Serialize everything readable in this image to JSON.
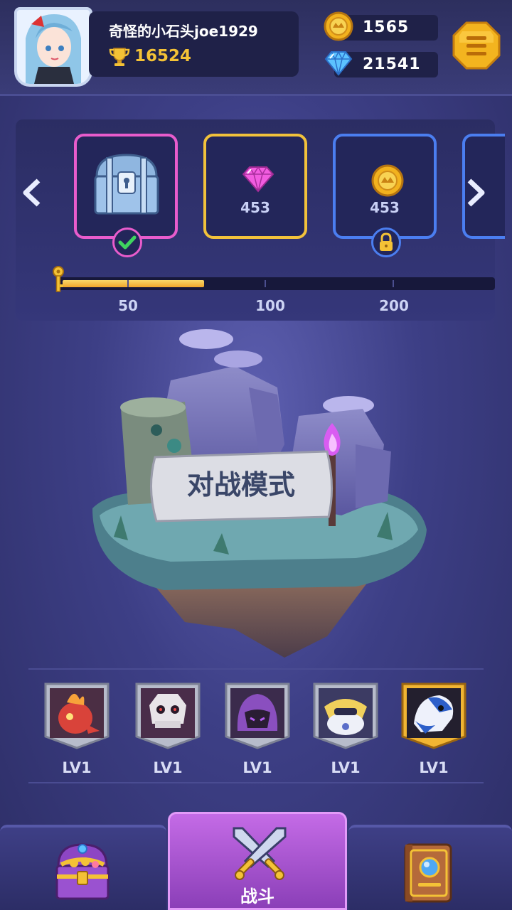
{
  "player": {
    "name": "奇怪的小石头joe1929",
    "trophies": "16524"
  },
  "currencies": {
    "gold": "1565",
    "diamonds": "21541"
  },
  "icons": {
    "menu": "menu-icon",
    "trophy": "trophy-icon",
    "gold": "gold-coin-icon",
    "diamond": "diamond-icon",
    "lock": "lock-icon",
    "check": "check-icon",
    "key": "key-icon",
    "treasure": "treasure-chest-icon",
    "battle": "crossed-swords-icon",
    "book": "spellbook-icon"
  },
  "rewards": [
    {
      "type": "chest",
      "value": "",
      "status": "claimed"
    },
    {
      "type": "diamond",
      "value": "453",
      "status": "available"
    },
    {
      "type": "gold",
      "value": "453",
      "status": "locked"
    }
  ],
  "progress": {
    "fraction": 0.33,
    "ticks": [
      "50",
      "100",
      "200"
    ]
  },
  "mode": {
    "title": "对战模式"
  },
  "heroes": [
    {
      "level": "LV1"
    },
    {
      "level": "LV1"
    },
    {
      "level": "LV1"
    },
    {
      "level": "LV1"
    },
    {
      "level": "LV1"
    }
  ],
  "nav": {
    "battle_label": "战斗"
  },
  "colors": {
    "gold": "#f4c236",
    "panel": "#2b2d63",
    "card_pink": "#e85ccc",
    "card_yellow": "#f2c23b",
    "card_blue": "#4b7ef0",
    "active_tab": "#b85bdc"
  }
}
